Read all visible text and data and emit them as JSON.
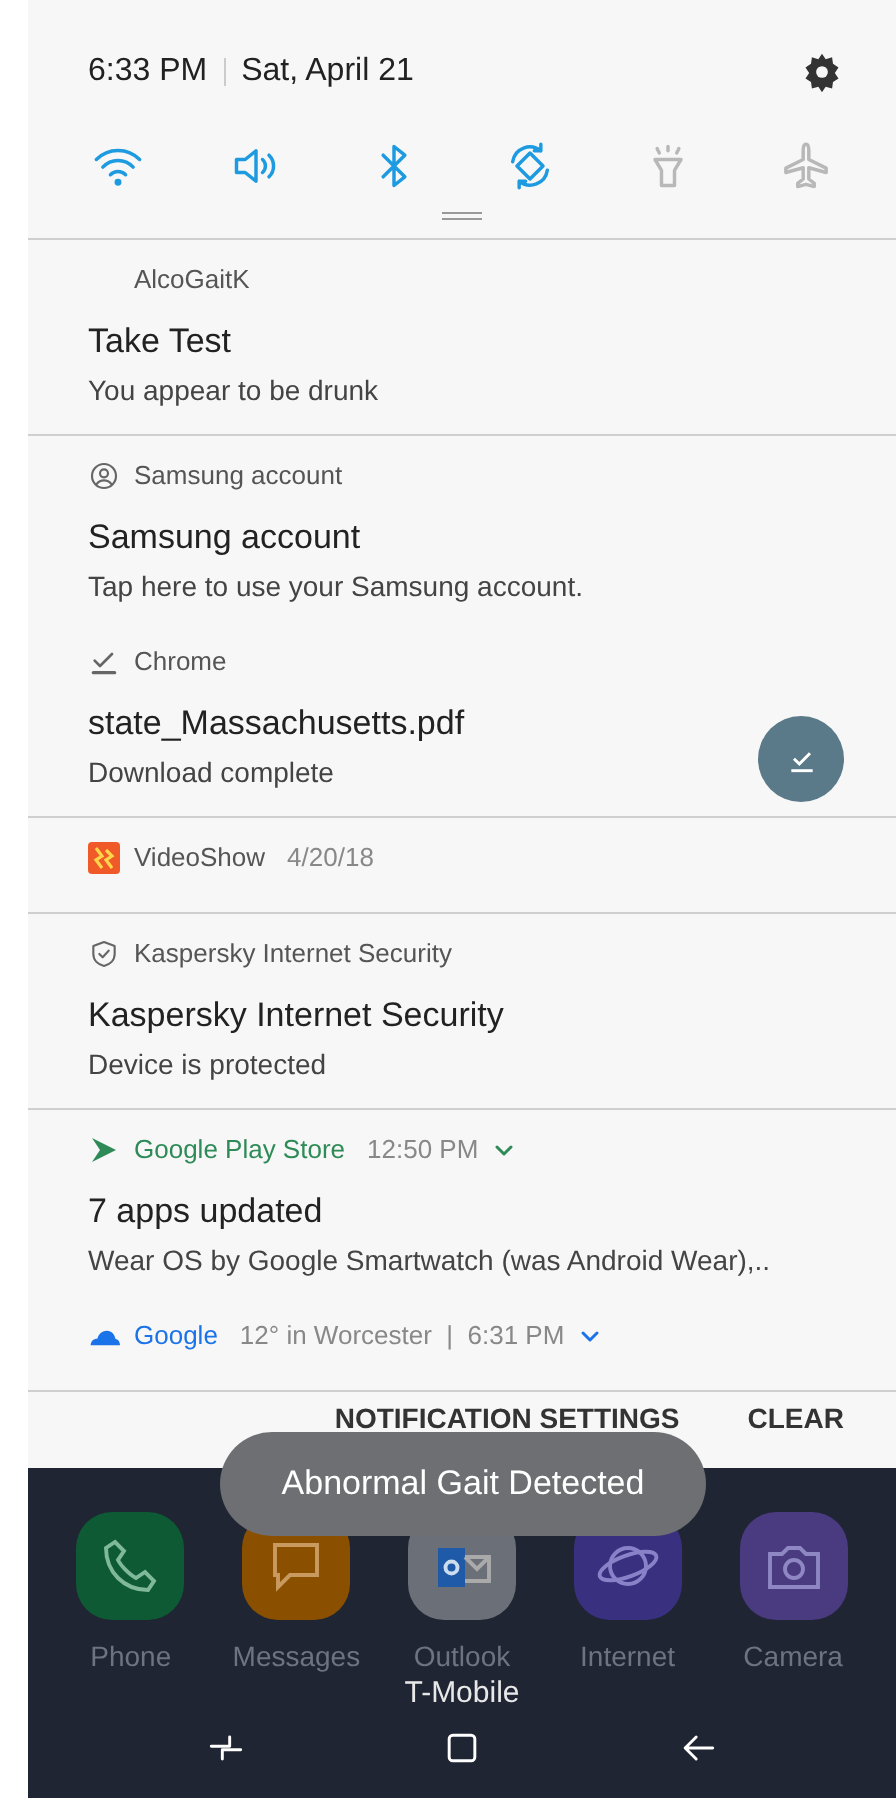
{
  "header": {
    "time": "6:33 PM",
    "date": "Sat, April 21"
  },
  "toggles": [
    {
      "kind": "wifi",
      "on": true
    },
    {
      "kind": "sound",
      "on": true
    },
    {
      "kind": "bluetooth",
      "on": true
    },
    {
      "kind": "rotate",
      "on": true
    },
    {
      "kind": "flashlight",
      "on": false
    },
    {
      "kind": "airplane",
      "on": false
    }
  ],
  "notification_groups": [
    {
      "items": [
        {
          "kind": "plain",
          "app": "AlcoGaitK",
          "title": "Take Test",
          "text": "You appear to be drunk"
        }
      ]
    },
    {
      "items": [
        {
          "kind": "account",
          "app": "Samsung account",
          "title": "Samsung account",
          "text": "Tap here to use your Samsung account."
        },
        {
          "kind": "download",
          "app": "Chrome",
          "title": "state_Massachusetts.pdf",
          "text": "Download complete"
        }
      ]
    },
    {
      "items": [
        {
          "kind": "video",
          "app": "VideoShow",
          "time": "4/20/18"
        }
      ]
    },
    {
      "items": [
        {
          "kind": "security",
          "app": "Kaspersky Internet Security",
          "title": "Kaspersky Internet Security",
          "text": "Device is protected"
        }
      ]
    },
    {
      "items": [
        {
          "kind": "store",
          "app": "Google Play Store",
          "color": "#2e8b57",
          "time": "12:50 PM",
          "expandable": true,
          "title": "7 apps updated",
          "text": "Wear OS by Google Smartwatch (was Android Wear),.."
        },
        {
          "kind": "weather",
          "app": "Google",
          "color": "#1a73e8",
          "time": "12° in Worcester  |  6:31 PM",
          "expandable": true
        }
      ]
    }
  ],
  "footer": {
    "buttons": [
      "NOTIFICATION SETTINGS",
      "CLEAR"
    ]
  },
  "toast": "Abnormal Gait Detected",
  "dock": [
    {
      "kind": "phone",
      "label": "Phone",
      "color": "#0d5a35"
    },
    {
      "kind": "messages",
      "label": "Messages",
      "color": "#8a5000"
    },
    {
      "kind": "outlook",
      "label": "Outlook",
      "color": "#6b6f78"
    },
    {
      "kind": "internet",
      "label": "Internet",
      "color": "#3a3080"
    },
    {
      "kind": "camera",
      "label": "Camera",
      "color": "#4a3a80"
    }
  ],
  "carrier": "T-Mobile"
}
